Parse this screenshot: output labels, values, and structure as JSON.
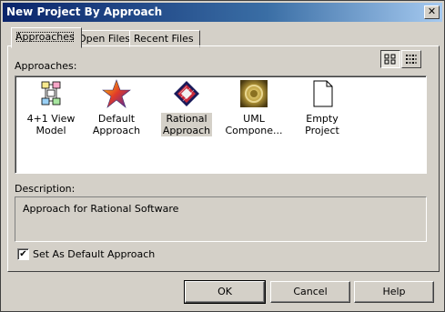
{
  "window": {
    "title": "New Project By Approach"
  },
  "tabs": [
    {
      "label": "Approaches",
      "active": true
    },
    {
      "label": "Open Files",
      "active": false
    },
    {
      "label": "Recent Files",
      "active": false
    }
  ],
  "approaches_label": "Approaches:",
  "view_mode": "large-icons",
  "approaches": [
    {
      "label": "4+1 View\nModel",
      "icon": "4plus1-view-icon",
      "selected": false
    },
    {
      "label": "Default\nApproach",
      "icon": "star-icon",
      "selected": false
    },
    {
      "label": "Rational\nApproach",
      "icon": "rational-icon",
      "selected": true
    },
    {
      "label": "UML\nCompone...",
      "icon": "uml-component-icon",
      "selected": false
    },
    {
      "label": "Empty Project",
      "icon": "blank-document-icon",
      "selected": false
    }
  ],
  "description_label": "Description:",
  "description_text": "Approach for Rational Software",
  "default_checkbox": {
    "label": "Set As Default Approach",
    "checked": true,
    "mark": "✔"
  },
  "buttons": {
    "ok": "OK",
    "cancel": "Cancel",
    "help": "Help"
  },
  "close_glyph": "✕"
}
